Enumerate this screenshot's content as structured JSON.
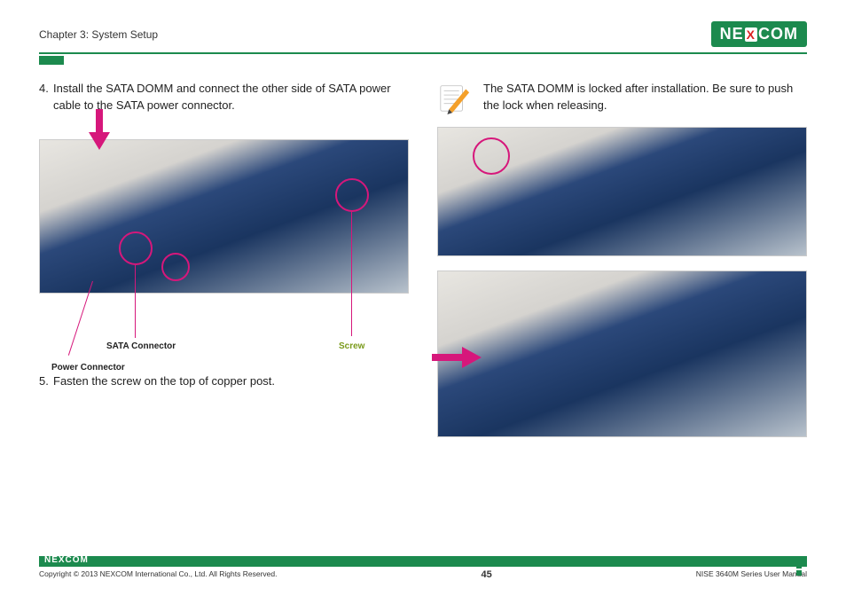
{
  "header": {
    "chapter": "Chapter 3: System Setup",
    "brand_left": "NE",
    "brand_x": "X",
    "brand_right": "COM"
  },
  "left": {
    "step4_num": "4.",
    "step4_text": "Install the SATA DOMM and connect the other side of SATA power cable to the SATA power connector.",
    "label_sata": "SATA Connector",
    "label_power": "Power Connector",
    "label_screw": "Screw",
    "step5_num": "5.",
    "step5_text": "Fasten the screw on the top of copper post."
  },
  "right": {
    "note_text": "The SATA DOMM is locked after installation. Be sure to push the lock when releasing."
  },
  "footer": {
    "brand": "NEXCOM",
    "copyright": "Copyright © 2013 NEXCOM International Co., Ltd. All Rights Reserved.",
    "page": "45",
    "doc": "NISE 3640M Series User Manual"
  }
}
